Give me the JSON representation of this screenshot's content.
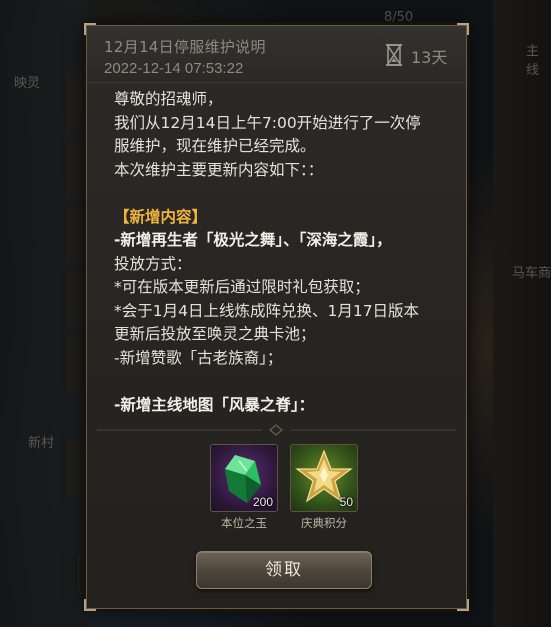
{
  "background": {
    "left_labels": [
      "映灵",
      "新村"
    ],
    "right_labels": [
      "主线",
      "马车商"
    ],
    "top_number": "8/50"
  },
  "dialog": {
    "title": "12月14日停服维护说明",
    "date": "2022-12-14 07:53:22",
    "expire_icon": "hourglass-icon",
    "expire_label": "13天",
    "body_lines": [
      {
        "text": "尊敬的招魂师，",
        "style": "normal"
      },
      {
        "text": "我们从12月14日上午7:00开始进行了一次停",
        "style": "normal"
      },
      {
        "text": "服维护，现在维护已经完成。",
        "style": "normal"
      },
      {
        "text": "本次维护主要更新内容如下：：",
        "style": "normal"
      },
      {
        "text": "",
        "style": "normal"
      },
      {
        "text": "【新增内容】",
        "style": "gold"
      },
      {
        "text": "-新增再生者「极光之舞」、「深海之霞」，",
        "style": "bold"
      },
      {
        "text": "投放方式：",
        "style": "normal"
      },
      {
        "text": "*可在版本更新后通过限时礼包获取；",
        "style": "normal"
      },
      {
        "text": "*会于1月4日上线炼成阵兑换、1月17日版本",
        "style": "normal"
      },
      {
        "text": "更新后投放至唤灵之典卡池；",
        "style": "normal"
      },
      {
        "text": "-新增赞歌「古老族裔」；",
        "style": "normal"
      },
      {
        "text": "",
        "style": "normal"
      },
      {
        "text": "-新增主线地图「风暴之脊」：",
        "style": "bold"
      }
    ],
    "rewards": [
      {
        "name": "本位之玉",
        "quantity": "200",
        "icon": "green-crystal-icon"
      },
      {
        "name": "庆典积分",
        "quantity": "50",
        "icon": "gold-star-icon"
      }
    ],
    "claim_label": "领取"
  },
  "colors": {
    "accent_gold": "#f0b33c",
    "body_text": "#e6e2da",
    "muted_text": "#8f8a80"
  }
}
